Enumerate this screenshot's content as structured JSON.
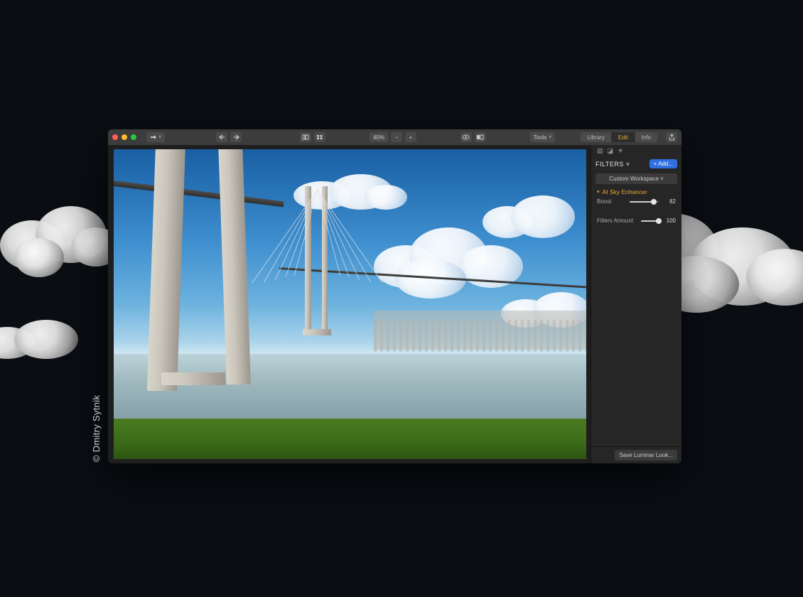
{
  "credit": "© Dmitry Sytnik",
  "toolbar": {
    "zoom_label": "40%",
    "tools_label": "Tools"
  },
  "main_tabs": {
    "library": "Library",
    "edit": "Edit",
    "info": "Info"
  },
  "panel": {
    "filters_title": "FILTERS ˅",
    "add_label": "+ Add...",
    "workspace_label": "Custom Workspace ˅",
    "filter_name": "AI Sky Enhancer",
    "boost_label": "Boost",
    "boost_value": "82",
    "amount_label": "Filters Amount",
    "amount_value": "100",
    "save_look_label": "Save Luminar Look..."
  },
  "sliders": {
    "boost_pct": 82,
    "amount_pct": 100
  }
}
